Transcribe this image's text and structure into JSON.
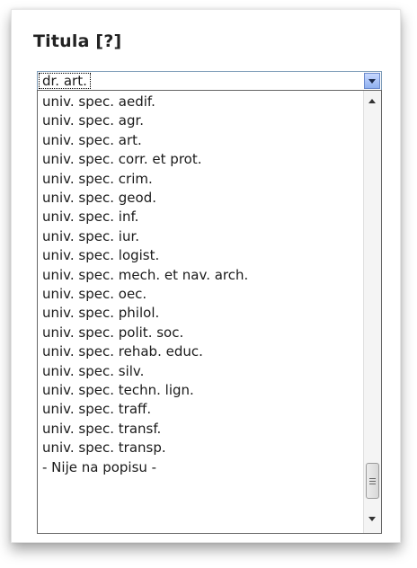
{
  "field": {
    "label": "Titula [?]"
  },
  "select": {
    "selected_value": "dr. art."
  },
  "options": [
    "univ. spec. aedif.",
    "univ. spec. agr.",
    "univ. spec. art.",
    "univ. spec. corr. et prot.",
    "univ. spec. crim.",
    "univ. spec. geod.",
    "univ. spec. inf.",
    "univ. spec. iur.",
    "univ. spec. logist.",
    "univ. spec. mech. et nav. arch.",
    "univ. spec. oec.",
    "univ. spec. philol.",
    "univ. spec. polit. soc.",
    "univ. spec. rehab. educ.",
    "univ. spec. silv.",
    "univ. spec. techn. lign.",
    "univ. spec. traff.",
    "univ. spec. transf.",
    "univ. spec. transp.",
    "- Nije na popisu -"
  ],
  "icons": {
    "dropdown_arrow": "chevron-down-icon",
    "scroll_up": "scroll-up-arrow-icon",
    "scroll_down": "scroll-down-arrow-icon"
  }
}
